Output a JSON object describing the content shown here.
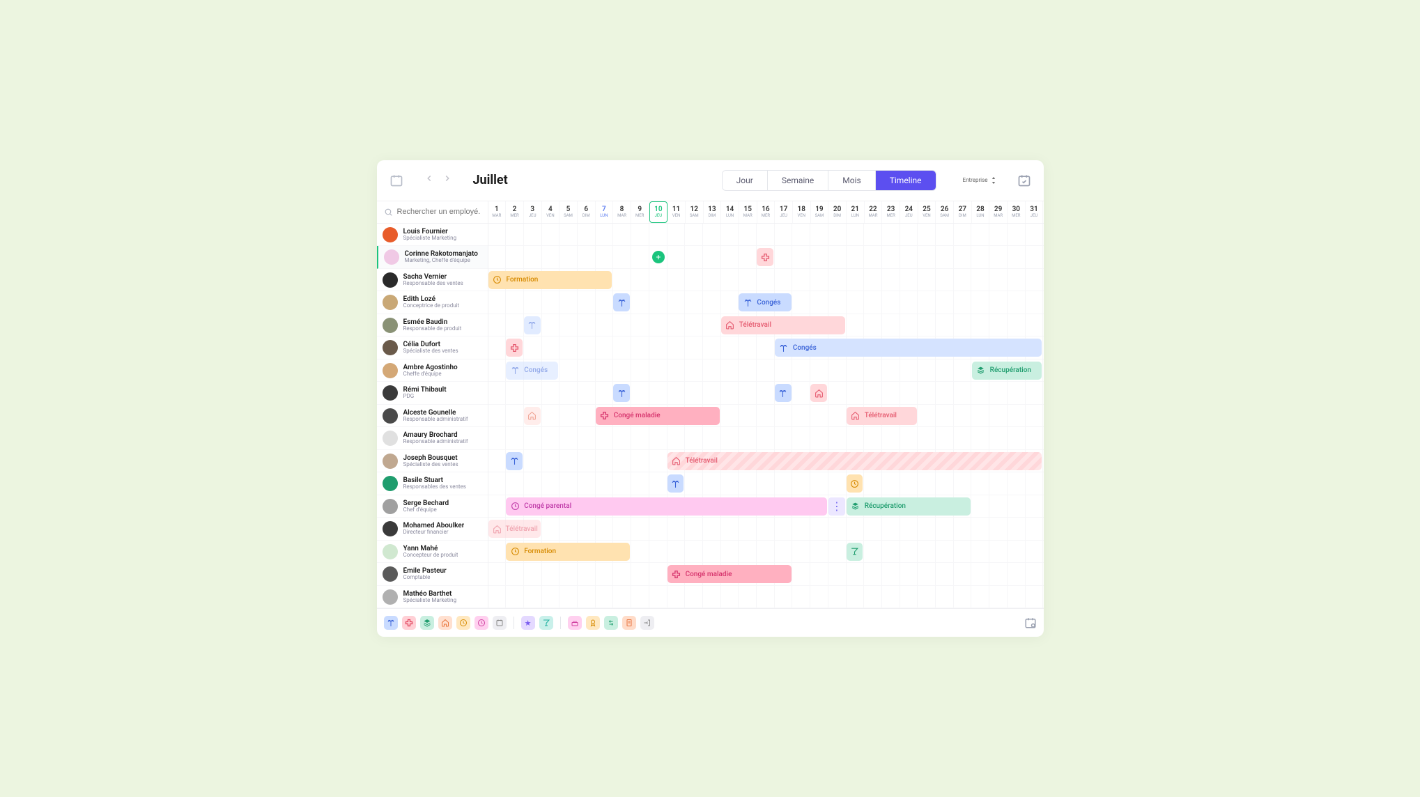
{
  "header": {
    "month": "Juillet",
    "views": [
      "Jour",
      "Semaine",
      "Mois",
      "Timeline"
    ],
    "active_view": "Timeline",
    "scope": "Entreprise"
  },
  "search": {
    "placeholder": "Rechercher un employé..."
  },
  "days": [
    {
      "n": "1",
      "d": "MAR"
    },
    {
      "n": "2",
      "d": "MER"
    },
    {
      "n": "3",
      "d": "JEU"
    },
    {
      "n": "4",
      "d": "VEN"
    },
    {
      "n": "5",
      "d": "SAM"
    },
    {
      "n": "6",
      "d": "DIM"
    },
    {
      "n": "7",
      "d": "LUN",
      "blue": true
    },
    {
      "n": "8",
      "d": "MAR"
    },
    {
      "n": "9",
      "d": "MER"
    },
    {
      "n": "10",
      "d": "JEU",
      "today": true
    },
    {
      "n": "11",
      "d": "VEN"
    },
    {
      "n": "12",
      "d": "SAM"
    },
    {
      "n": "13",
      "d": "DIM"
    },
    {
      "n": "14",
      "d": "LUN"
    },
    {
      "n": "15",
      "d": "MAR"
    },
    {
      "n": "16",
      "d": "MER"
    },
    {
      "n": "17",
      "d": "JEU"
    },
    {
      "n": "18",
      "d": "VEN"
    },
    {
      "n": "19",
      "d": "SAM"
    },
    {
      "n": "20",
      "d": "DIM"
    },
    {
      "n": "21",
      "d": "LUN"
    },
    {
      "n": "22",
      "d": "MAR"
    },
    {
      "n": "23",
      "d": "MER"
    },
    {
      "n": "24",
      "d": "JEU"
    },
    {
      "n": "25",
      "d": "VEN"
    },
    {
      "n": "26",
      "d": "SAM"
    },
    {
      "n": "27",
      "d": "DIM"
    },
    {
      "n": "28",
      "d": "LUN"
    },
    {
      "n": "29",
      "d": "MAR"
    },
    {
      "n": "30",
      "d": "MER"
    },
    {
      "n": "31",
      "d": "JEU"
    }
  ],
  "employees": [
    {
      "name": "Louis Fournier",
      "role": "Spécialiste Marketing",
      "color": "#e85c2a"
    },
    {
      "name": "Corinne Rakotomanjato",
      "role": "Marketing, Cheffe d'équipe",
      "color": "#f0c9e5",
      "selected": true
    },
    {
      "name": "Sacha Vernier",
      "role": "Responsable des ventes",
      "color": "#2a2a2a"
    },
    {
      "name": "Edith Lozé",
      "role": "Conceptrice de produit",
      "color": "#c9a876"
    },
    {
      "name": "Esmée Baudin",
      "role": "Responsable de produit",
      "color": "#8a9276"
    },
    {
      "name": "Célia Dufort",
      "role": "Spécialiste des ventes",
      "color": "#6a5a4a"
    },
    {
      "name": "Ambre Agostinho",
      "role": "Cheffe d'équipe",
      "color": "#d4a876"
    },
    {
      "name": "Rémi Thibault",
      "role": "PDG",
      "color": "#3a3a3a"
    },
    {
      "name": "Alceste Gounelle",
      "role": "Responsable administratif",
      "color": "#4a4a4a"
    },
    {
      "name": "Amaury Brochard",
      "role": "Responsable administratif",
      "color": "#e0e0e0"
    },
    {
      "name": "Joseph Bousquet",
      "role": "Spécialiste des ventes",
      "color": "#c0a890"
    },
    {
      "name": "Basile Stuart",
      "role": "Responsables des ventes",
      "color": "#1f9d6e"
    },
    {
      "name": "Serge Bechard",
      "role": "Chef d'équipe",
      "color": "#a0a0a0"
    },
    {
      "name": "Mohamed Aboulker",
      "role": "Directeur financier",
      "color": "#3a3a3a"
    },
    {
      "name": "Yann Mahé",
      "role": "Concepteur de produit",
      "color": "#d0e8d0"
    },
    {
      "name": "Émile Pasteur",
      "role": "Comptable",
      "color": "#5a5a5a"
    },
    {
      "name": "Mathéo Barthet",
      "role": "Spécialiste Marketing",
      "color": "#b0b0b0"
    }
  ],
  "events": {
    "formation": "Formation",
    "conges": "Congés",
    "teletravail": "Télétravail",
    "conge_maladie": "Congé maladie",
    "conge_parental": "Congé parental",
    "recuperation": "Récupération"
  },
  "legend_icons": [
    "palm",
    "medical",
    "layers",
    "home",
    "clock",
    "clock2",
    "calendar",
    "star",
    "cocktail",
    "cake",
    "medal",
    "swap",
    "doc",
    "exit"
  ]
}
